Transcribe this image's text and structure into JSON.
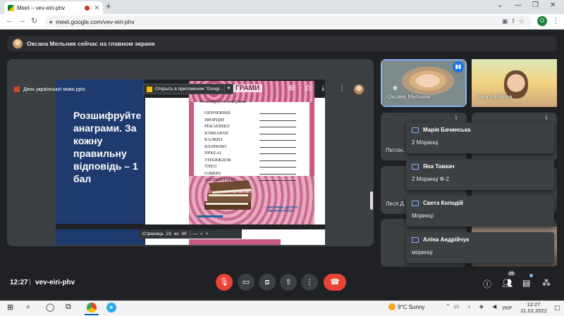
{
  "browser": {
    "tab_title": "Meet – vev-eiri-phv",
    "tab_close": "✕",
    "new_tab": "+",
    "url": "meet.google.com/vev-eiri-phv",
    "profile_letter": "O",
    "window_controls": [
      "⌄",
      "—",
      "❐",
      "✕"
    ]
  },
  "notice": {
    "text": "Оксана Мельник сейчас на главном экране"
  },
  "presentation": {
    "file_name": "День української мови.pptx",
    "open_with_label": "Открыть в приложении \"Googl...",
    "slide_text": "Розшифруйте анаграми. За кожну правильну відповідь – 1 бал",
    "doc_header_fragment": "ГРАМИ",
    "doc_subtitle": "Розшифруйте анаграми.",
    "anagrams": [
      "ОЕНЧЕКВШ",
      "ІМОРЦІН",
      "РЕКАЕВІКЛ",
      "КТИЕАРАН",
      "КАЛКВЗ",
      "ВЛЛРЮБО",
      "ПРКЕАІ",
      "УНХИЖДОК",
      "ТПЕО",
      "ОЗБКРА",
      "ДЛІТЬРЕТАНЕ"
    ],
    "publisher_logo": "ЗВЕТНЯНА ДИТИНА ЗВЕРНЯЯ КРАЇНА",
    "page_label": "Страница",
    "page_current": "23",
    "page_of": "из",
    "page_total": "30",
    "zoom_out": "—",
    "zoom_in": "+"
  },
  "participants": [
    {
      "name": "Оксана Мельник"
    },
    {
      "name": "Інна Бабійчук"
    },
    {
      "name": "Петлін..."
    },
    {
      "name": "Леся Д..."
    }
  ],
  "chat_toasts": [
    {
      "sender": "Марія Бачинська",
      "message": "2 Моринці"
    },
    {
      "sender": "Яна Товкач",
      "message": "2 Моринці Ф-2"
    },
    {
      "sender": "Света Колодій",
      "message": "Моринці"
    },
    {
      "sender": "Аліна Андрійчук",
      "message": "моринці"
    }
  ],
  "meeting": {
    "time": "12:27",
    "separator": "|",
    "code": "vev-eiri-phv",
    "participant_count": "39"
  },
  "taskbar": {
    "temperature": "9°C",
    "weather": "Sunny",
    "language": "УКР",
    "clock_time": "12:27",
    "clock_date": "21.02.2022"
  }
}
